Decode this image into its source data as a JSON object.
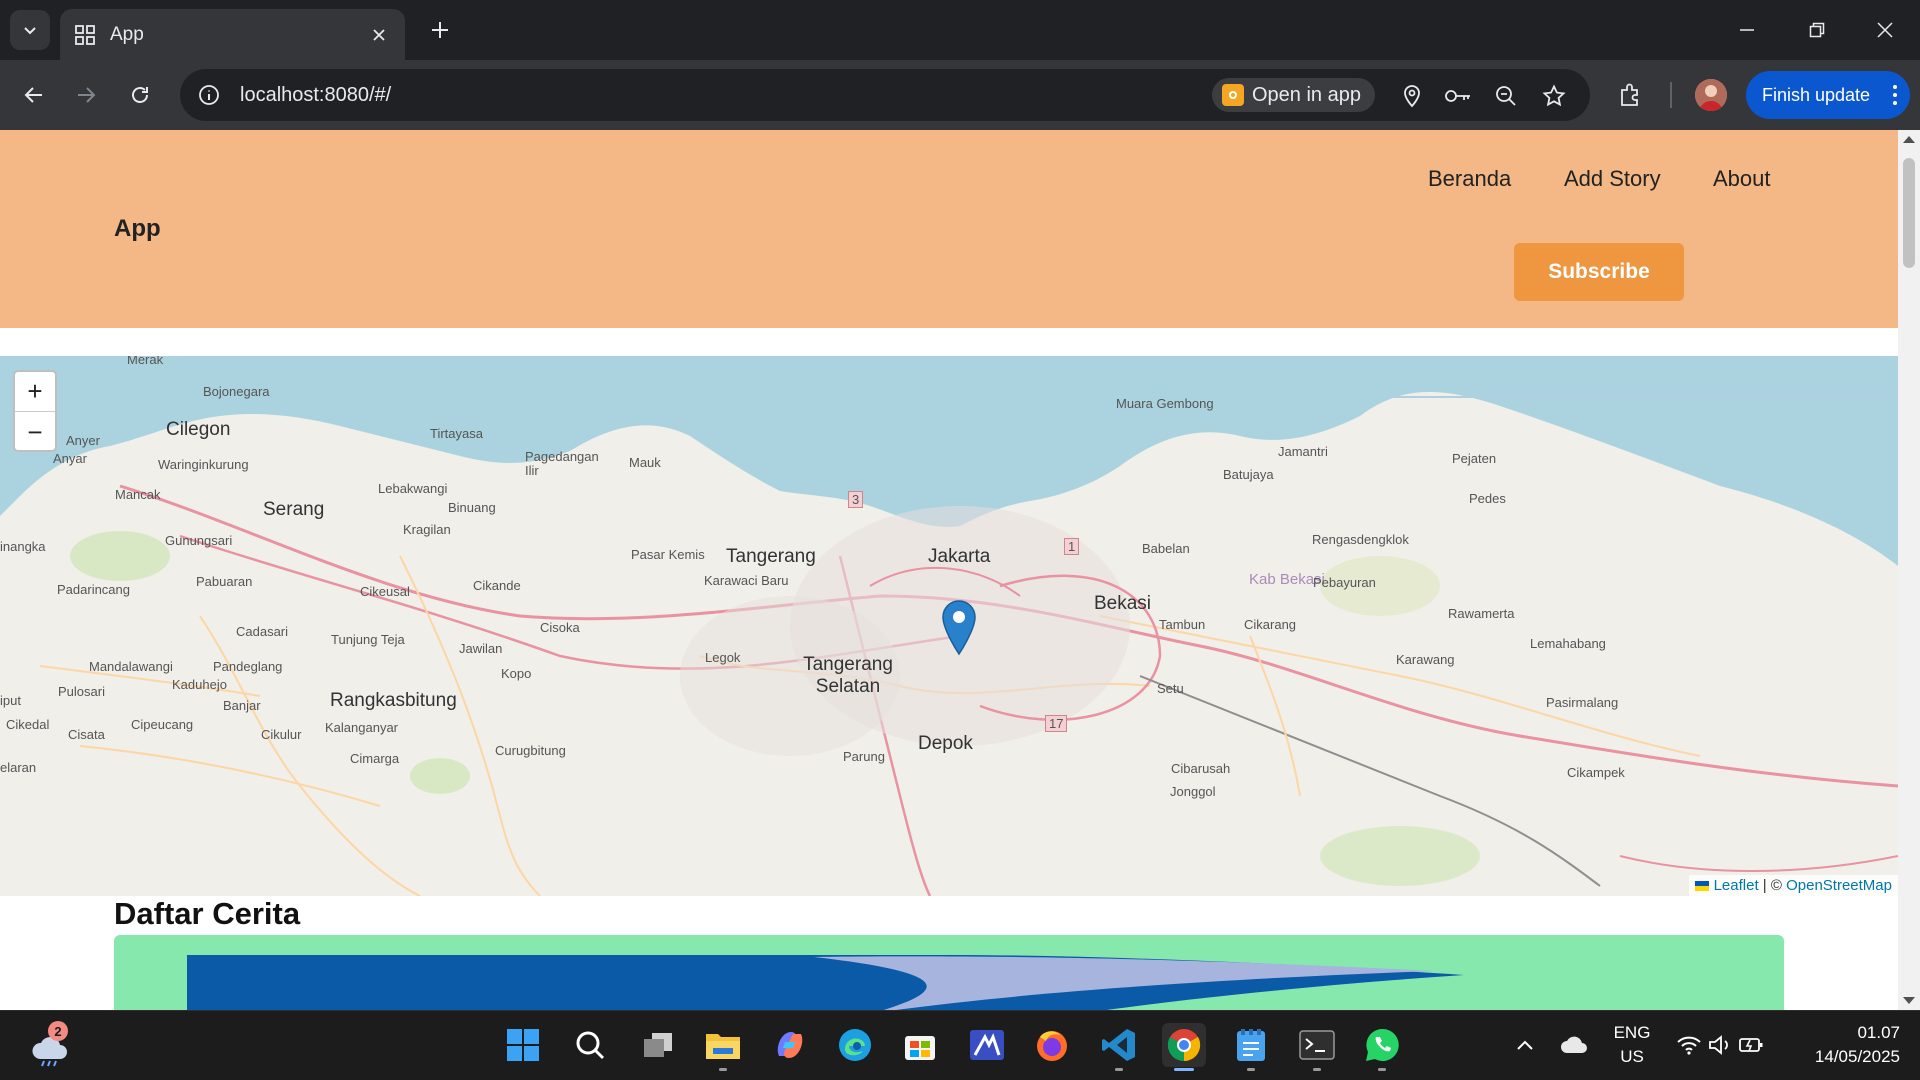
{
  "browser": {
    "tab_title": "App",
    "url": "localhost:8080/#/",
    "open_in_app": "Open in app",
    "finish_update": "Finish update"
  },
  "page": {
    "brand": "App",
    "nav": [
      "Beranda",
      "Add Story",
      "About"
    ],
    "subscribe": "Subscribe",
    "section_title": "Daftar Cerita"
  },
  "map": {
    "zoom_in": "+",
    "zoom_out": "−",
    "attribution_leaflet": "Leaflet",
    "attribution_sep": " | © ",
    "attribution_osm": "OpenStreetMap",
    "labels": {
      "merak": "Merak",
      "bojonegara": "Bojonegara",
      "cilegon": "Cilegon",
      "anyer": "Anyer",
      "anyar": "Anyar",
      "waringinkurung": "Waringinkurung",
      "tirtayasa": "Tirtayasa",
      "pagedangan_ilir": "Pagedangan Ilir",
      "mauk": "Mauk",
      "mancak": "Mancak",
      "serang": "Serang",
      "lebakwangi": "Lebakwangi",
      "binuang": "Binuang",
      "kragilan": "Kragilan",
      "gunungsari": "Gunungsari",
      "inangka": "inangka",
      "pasar_kemis": "Pasar Kemis",
      "tangerang": "Tangerang",
      "karawaci_baru": "Karawaci Baru",
      "jakarta": "Jakarta",
      "padarincang": "Padarincang",
      "pabuaran": "Pabuaran",
      "cikeusal": "Cikeusal",
      "cikande": "Cikande",
      "cadasari": "Cadasari",
      "tunjung_teja": "Tunjung Teja",
      "jawilan": "Jawilan",
      "cisoka": "Cisoka",
      "legok": "Legok",
      "tangerang_selatan": "Tangerang Selatan",
      "mandalawangi": "Mandalawangi",
      "pandeglang": "Pandeglang",
      "kaduhejo": "Kaduhejo",
      "kopo": "Kopo",
      "pulosari": "Pulosari",
      "iput": "iput",
      "banjar": "Banjar",
      "rangkasbitung": "Rangkasbitung",
      "cikedal": "Cikedal",
      "cisata": "Cisata",
      "cipeucang": "Cipeucang",
      "cikulur": "Cikulur",
      "kalanganyar": "Kalanganyar",
      "cimarga": "Cimarga",
      "curugbitung": "Curugbitung",
      "elaran": "elaran",
      "parung": "Parung",
      "depok": "Depok",
      "muara_gembong": "Muara Gembong",
      "jamantri": "Jamantri",
      "pejaten": "Pejaten",
      "batujaya": "Batujaya",
      "pedes": "Pedes",
      "rengasdengklok": "Rengasdengklok",
      "babelan": "Babelan",
      "kab_bekasi": "Kab Bekasi",
      "pebayuran": "Pebayuran",
      "bekasi": "Bekasi",
      "tambun": "Tambun",
      "cikarang": "Cikarang",
      "rawamerta": "Rawamerta",
      "lemahabang": "Lemahabang",
      "karawang": "Karawang",
      "setu": "Setu",
      "pasirmalang": "Pasirmalang",
      "cibarusah": "Cibarusah",
      "cikampek": "Cikampek",
      "jonggol": "Jonggol",
      "road3": "3",
      "road1": "1",
      "road17": "17"
    }
  },
  "taskbar": {
    "badge": "2",
    "lang1": "ENG",
    "lang2": "US",
    "time": "01.07",
    "date": "14/05/2025"
  },
  "colors": {
    "header": "#f3b885",
    "subscribe": "#ee9640",
    "card": "#86e8ad",
    "sea": "#aad3df",
    "marker": "#2a81cb"
  }
}
